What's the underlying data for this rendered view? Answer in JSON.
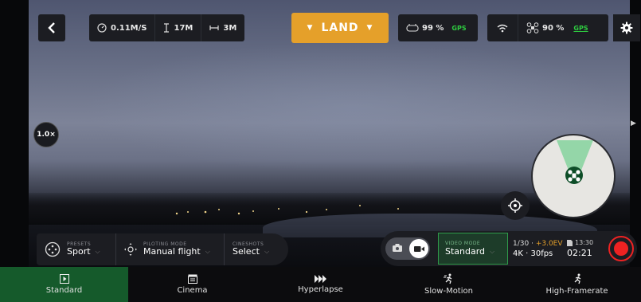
{
  "topbar": {
    "speed": "0.11M/S",
    "altitude": "17M",
    "distance": "3M",
    "land_label": "LAND",
    "controller_battery": "99 %",
    "controller_gps": "GPS",
    "drone_battery": "90 %",
    "drone_gps": "GPS"
  },
  "zoom_level": "1.0×",
  "presets": {
    "caption": "PRESETS",
    "value": "Sport"
  },
  "piloting": {
    "caption": "PILOTING MODE",
    "value": "Manual flight"
  },
  "cineshots": {
    "caption": "CINESHOTS",
    "value": "Select"
  },
  "video_mode": {
    "caption": "VIDEO MODE",
    "value": "Standard"
  },
  "exposure": {
    "shutter": "1/30",
    "ev": "+3.0EV",
    "resolution": "4K",
    "framerate": "30fps"
  },
  "recording": {
    "storage_time": "13:30",
    "remaining": "02:21"
  },
  "modes": [
    {
      "label": "Standard",
      "icon": "play-icon"
    },
    {
      "label": "Cinema",
      "icon": "clapper-icon"
    },
    {
      "label": "Hyperlapse",
      "icon": "fast-forward-icon"
    },
    {
      "label": "Slow-Motion",
      "icon": "slow-runner-icon"
    },
    {
      "label": "High-Framerate",
      "icon": "runner-icon"
    }
  ],
  "colors": {
    "accent_land": "#e5a02a",
    "active_mode": "#155a2b",
    "gps": "#2ecc40",
    "record": "#e22222"
  }
}
